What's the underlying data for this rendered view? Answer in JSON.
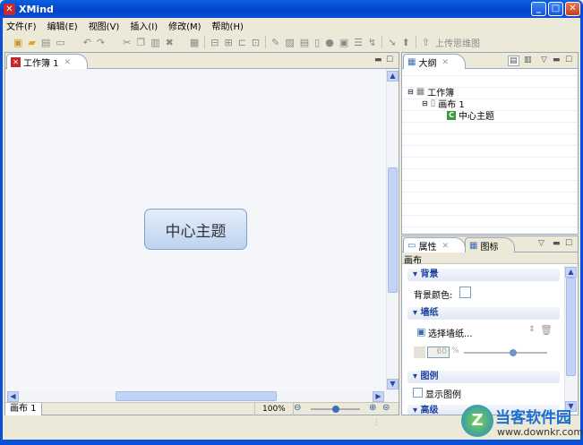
{
  "window": {
    "title": "XMind",
    "min": "_",
    "max": "□",
    "close": "✕"
  },
  "menu": [
    "文件(F)",
    "编辑(E)",
    "视图(V)",
    "插入(I)",
    "修改(M)",
    "帮助(H)"
  ],
  "toolbar": {
    "icons": [
      "new-icon",
      "open-icon",
      "save-icon",
      "print-icon",
      "undo-icon",
      "redo-icon",
      "cut-icon",
      "copy-icon",
      "paste-icon",
      "delete-icon",
      "insert-image-icon",
      "topic-icon",
      "subtopic-icon",
      "parent-icon",
      "float-icon",
      "attachment-icon",
      "picture-icon",
      "boundary-icon",
      "note-icon",
      "marker-icon",
      "summary-icon",
      "align-icon",
      "relationship-icon",
      "drill-down-icon",
      "drill-up-icon"
    ],
    "upload_label": "上传思维图"
  },
  "editor": {
    "tab_label": "工作簿 1",
    "central_topic": "中心主题",
    "sheet_tab": "画布 1",
    "zoom": "100%",
    "zoom_level": 0.55
  },
  "outline": {
    "tab_label": "大纲",
    "tree": [
      {
        "label": "工作簿",
        "level": 0
      },
      {
        "label": "画布 1",
        "level": 1
      },
      {
        "label": "中心主题",
        "level": 2
      }
    ]
  },
  "properties": {
    "tab_label": "属性",
    "tab2_label": "图标",
    "context": "画布",
    "sections": {
      "background": "背景",
      "background_color_label": "背景颜色:",
      "wallpaper": "墙纸",
      "select_wallpaper": "选择墙纸...",
      "opacity": "60",
      "percent": "%",
      "legend": "图例",
      "show_legend": "显示图例",
      "advanced": "高级"
    },
    "opacity_fraction": 0.6
  },
  "watermark": {
    "text": "当客软件园",
    "url": "www.downkr.com"
  }
}
